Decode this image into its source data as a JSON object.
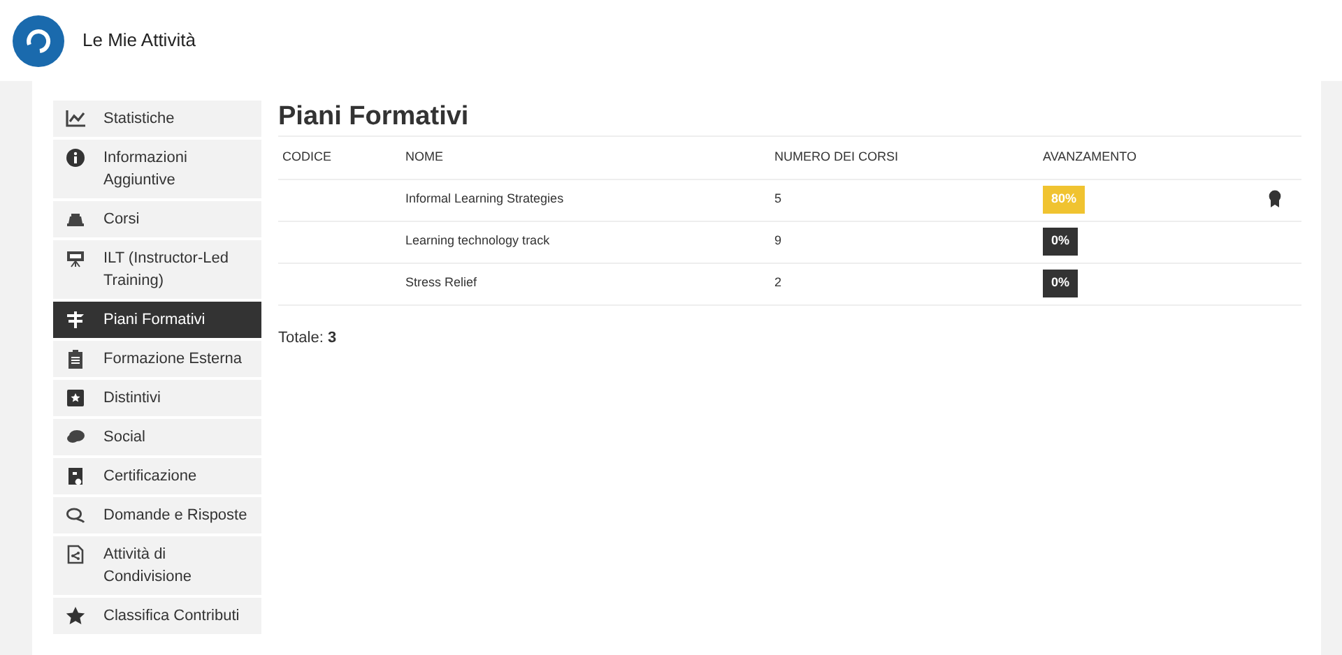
{
  "header": {
    "title": "Le Mie Attività"
  },
  "sidebar": {
    "items": [
      {
        "label": "Statistiche",
        "selected": false
      },
      {
        "label": "Informazioni Aggiuntive",
        "selected": false
      },
      {
        "label": "Corsi",
        "selected": false
      },
      {
        "label": "ILT (Instructor-Led Training)",
        "selected": false
      },
      {
        "label": "Piani Formativi",
        "selected": true
      },
      {
        "label": "Formazione Esterna",
        "selected": false
      },
      {
        "label": "Distintivi",
        "selected": false
      },
      {
        "label": "Social",
        "selected": false
      },
      {
        "label": "Certificazione",
        "selected": false
      },
      {
        "label": "Domande e Risposte",
        "selected": false
      },
      {
        "label": "Attività di Condivisione",
        "selected": false
      },
      {
        "label": "Classifica Contributi",
        "selected": false
      }
    ]
  },
  "main": {
    "title": "Piani Formativi",
    "table": {
      "columns": [
        "CODICE",
        "NOME",
        "NUMERO DEI CORSI",
        "AVANZAMENTO"
      ],
      "rows": [
        {
          "name": "Informal Learning Strategies",
          "courses": "5",
          "progress": "80%",
          "color": "#f0c330",
          "certificate": true
        },
        {
          "name": "Learning technology track",
          "courses": "9",
          "progress": "0%",
          "color": "#333333",
          "certificate": false
        },
        {
          "name": "Stress Relief",
          "courses": "2",
          "progress": "0%",
          "color": "#333333",
          "certificate": false
        }
      ]
    },
    "total": "Totale: **3**"
  }
}
